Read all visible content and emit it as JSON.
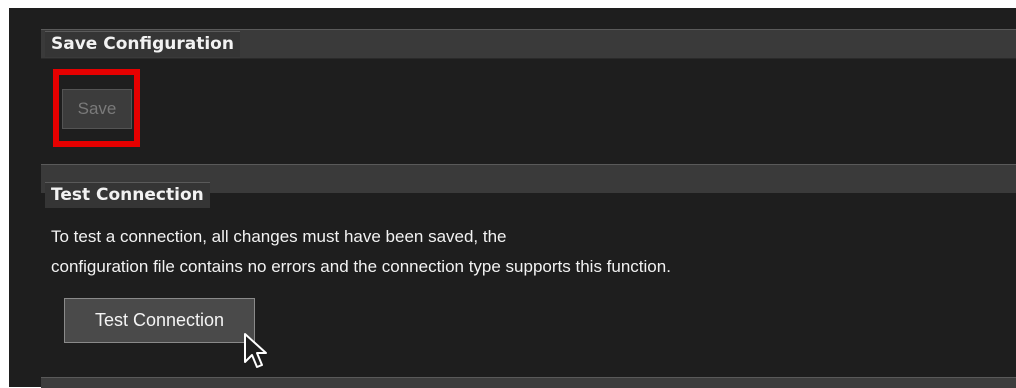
{
  "sections": {
    "save": {
      "title": "Save Configuration",
      "button_label": "Save",
      "button_enabled": false,
      "highlight_color": "#e60000"
    },
    "test": {
      "title": "Test Connection",
      "description_line1": "To test a connection, all changes must have been saved, the",
      "description_line2": "configuration file contains no errors and the connection type supports this function.",
      "button_label": "Test Connection"
    }
  },
  "theme": {
    "background": "#1e1e1e",
    "header": "#3a3a3a",
    "text": "#f2f2f2"
  },
  "cursor": "arrow-pointer-icon"
}
